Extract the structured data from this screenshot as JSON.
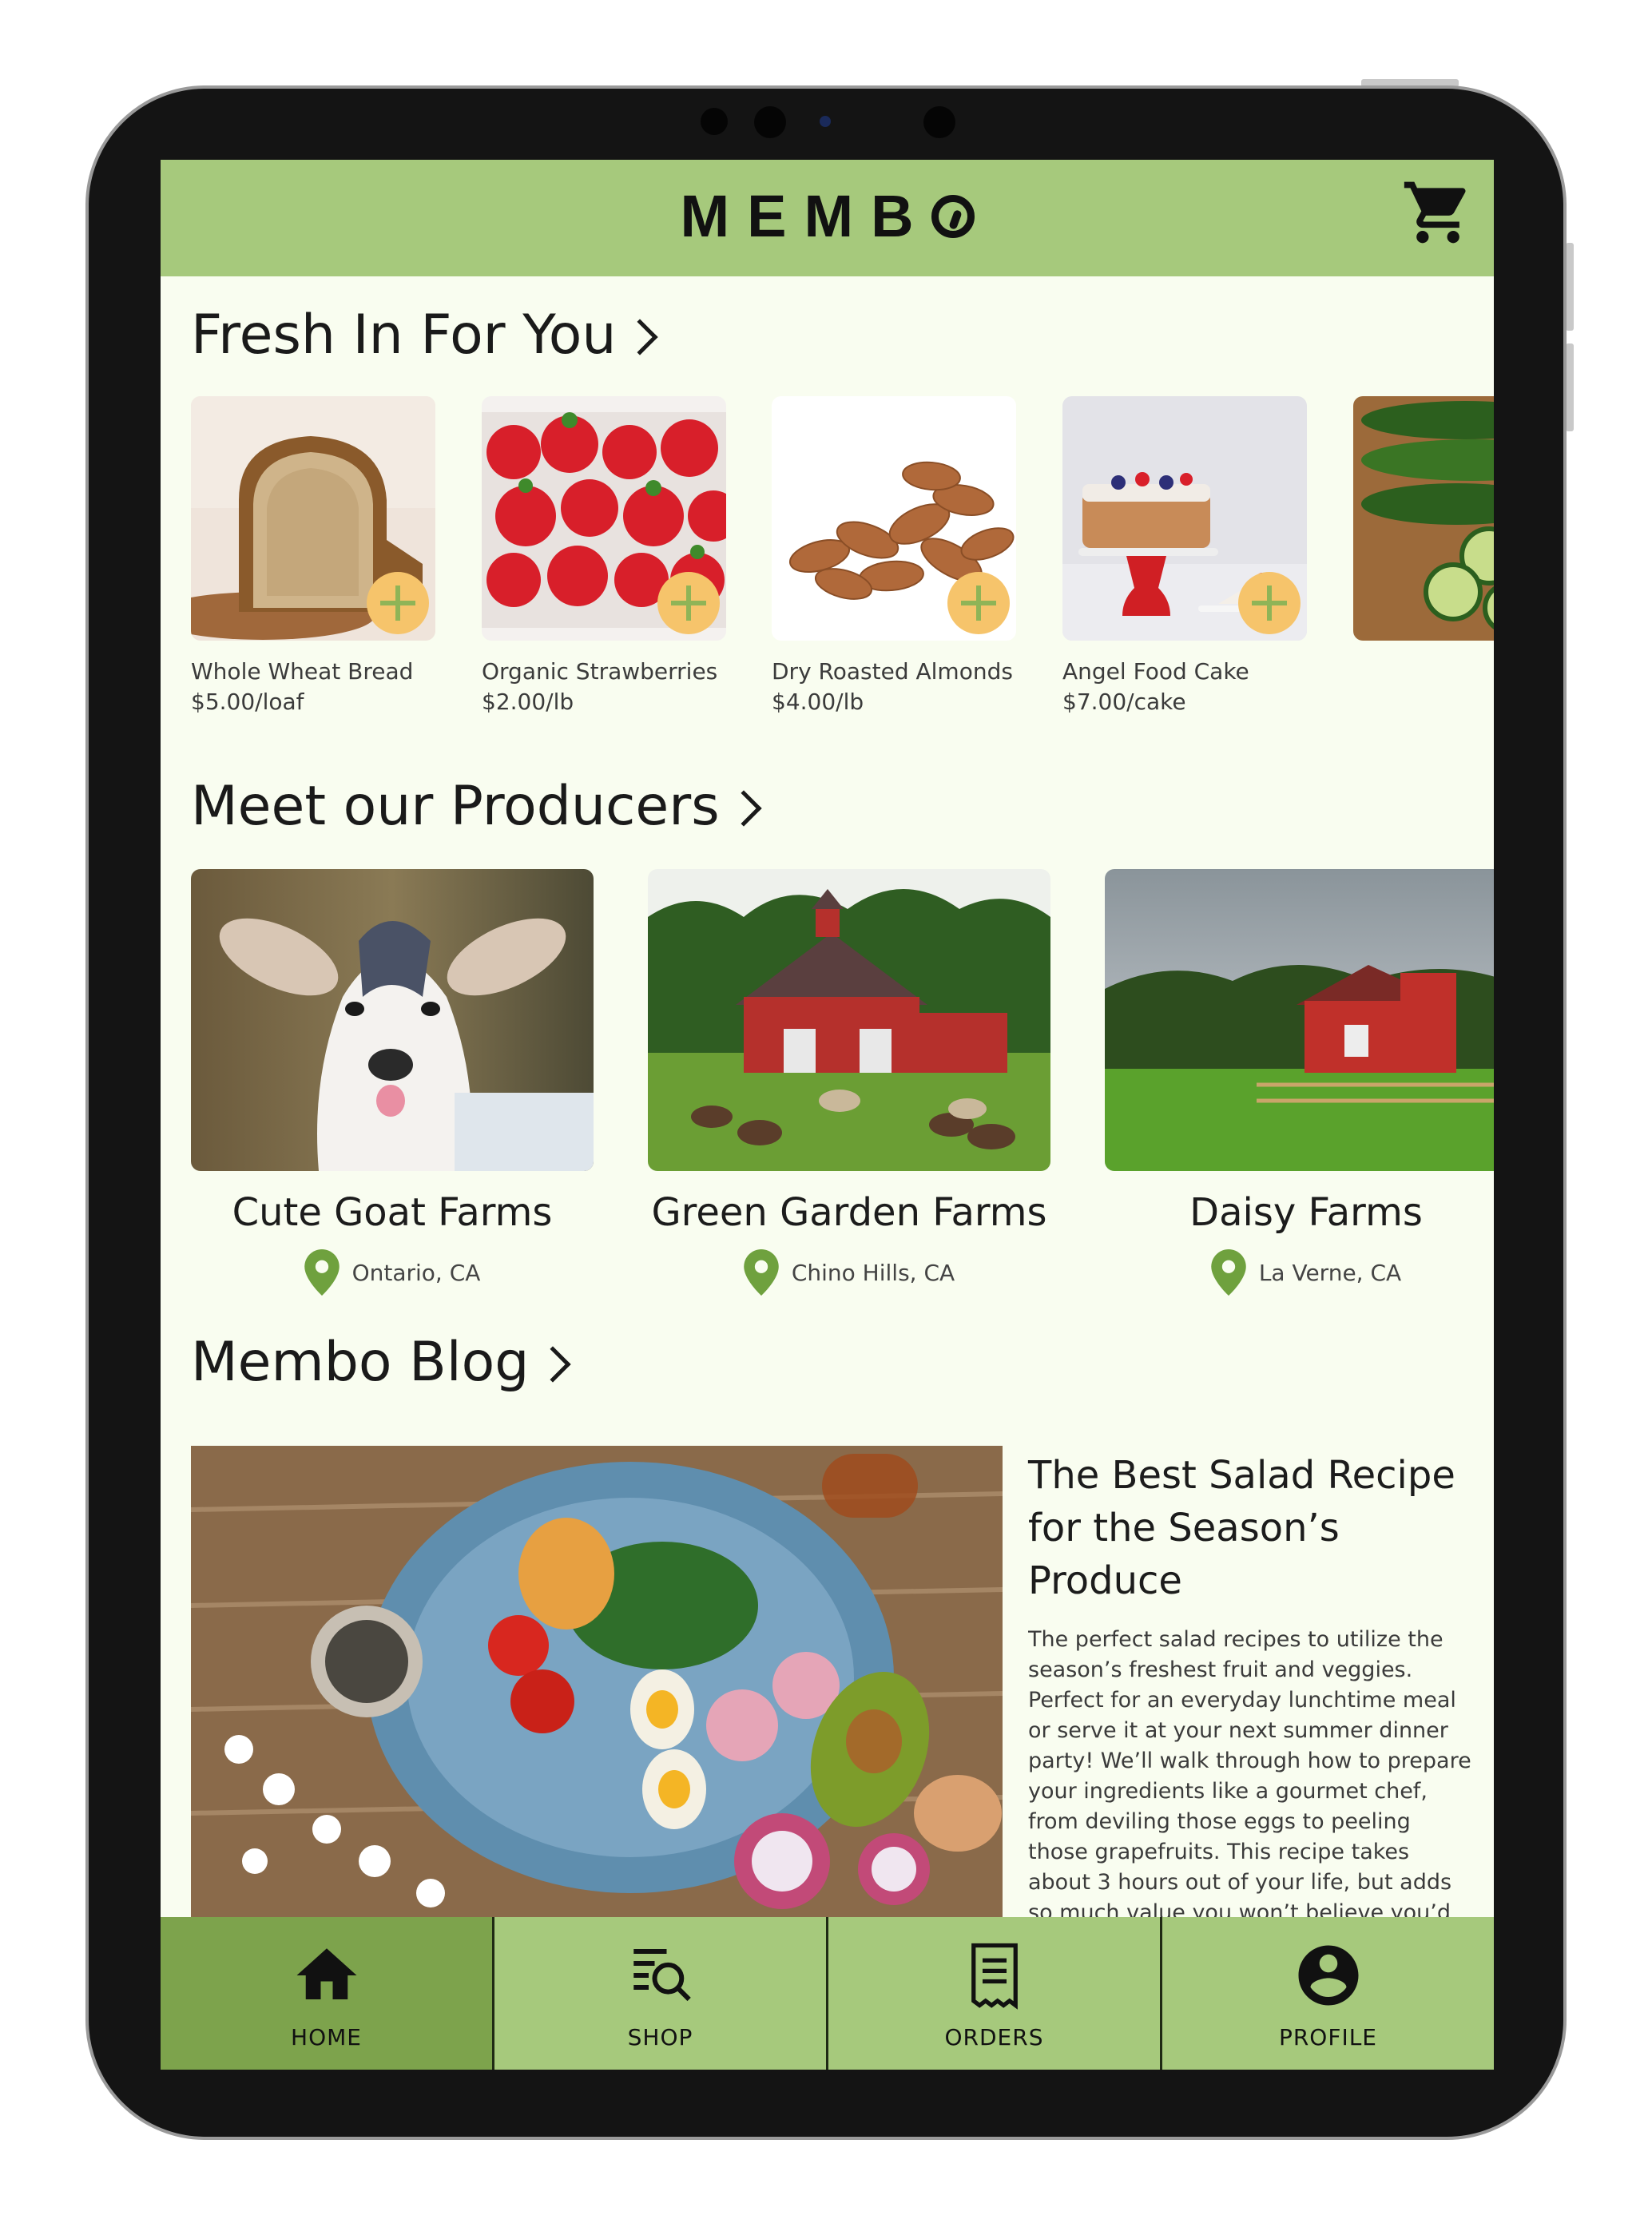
{
  "app": {
    "logo_text": "MEMB"
  },
  "colors": {
    "accent": "#a6c97c",
    "accent_dark": "#7da34c",
    "add_button": "#f6c46b",
    "background": "#f9fdf0"
  },
  "sections": {
    "fresh": {
      "title": "Fresh In For You"
    },
    "producers": {
      "title": "Meet our Producers"
    },
    "blog": {
      "title": "Membo Blog"
    }
  },
  "products": [
    {
      "name": "Whole Wheat Bread",
      "price": "$5.00/loaf",
      "icon": "bread-image"
    },
    {
      "name": "Organic Strawberries",
      "price": "$2.00/lb",
      "icon": "strawberries-image"
    },
    {
      "name": "Dry Roasted Almonds",
      "price": "$4.00/lb",
      "icon": "almonds-image"
    },
    {
      "name": "Angel Food Cake",
      "price": "$7.00/cake",
      "icon": "cake-image"
    },
    {
      "name": "",
      "price": "",
      "icon": "cucumbers-image"
    }
  ],
  "producers": [
    {
      "name": "Cute Goat Farms",
      "location": "Ontario, CA"
    },
    {
      "name": "Green Garden Farms",
      "location": "Chino Hills, CA"
    },
    {
      "name": "Daisy Farms",
      "location": "La Verne, CA"
    }
  ],
  "blog_post": {
    "title": "The Best Salad Recipe for the Season’s Produce",
    "body": "The perfect salad recipes to utilize the season’s freshest fruit and veggies. Perfect for an everyday lunchtime meal or serve it at your next summer dinner party! We’ll walk through how to prepare your ingredients like a gourmet chef, from deviling those eggs to peeling those grapefruits. This recipe takes about 3 hours out of your life, but adds so much value you won’t believe you’d ever..."
  },
  "nav": {
    "home": "HOME",
    "shop": "SHOP",
    "orders": "ORDERS",
    "profile": "PROFILE"
  }
}
